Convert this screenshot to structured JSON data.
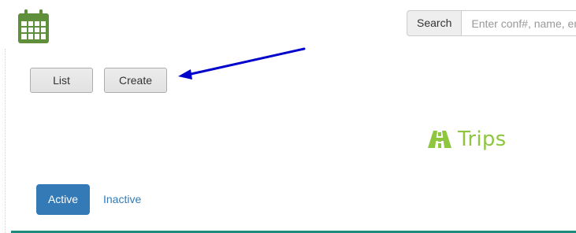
{
  "header": {
    "app_icon": "calendar-icon",
    "search": {
      "label": "Search",
      "placeholder": "Enter conf#, name, email"
    }
  },
  "toolbar": {
    "list_label": "List",
    "create_label": "Create"
  },
  "annotation": {
    "arrow_color": "#0000cc"
  },
  "section": {
    "icon": "road-icon",
    "title": "Trips",
    "title_color": "#8ec63f"
  },
  "tabs": [
    {
      "label": "Active",
      "selected": true
    },
    {
      "label": "Inactive",
      "selected": false
    }
  ],
  "colors": {
    "primary": "#337ab7",
    "accent_line": "#1c8c7c",
    "icon_green": "#5a8a3a"
  }
}
